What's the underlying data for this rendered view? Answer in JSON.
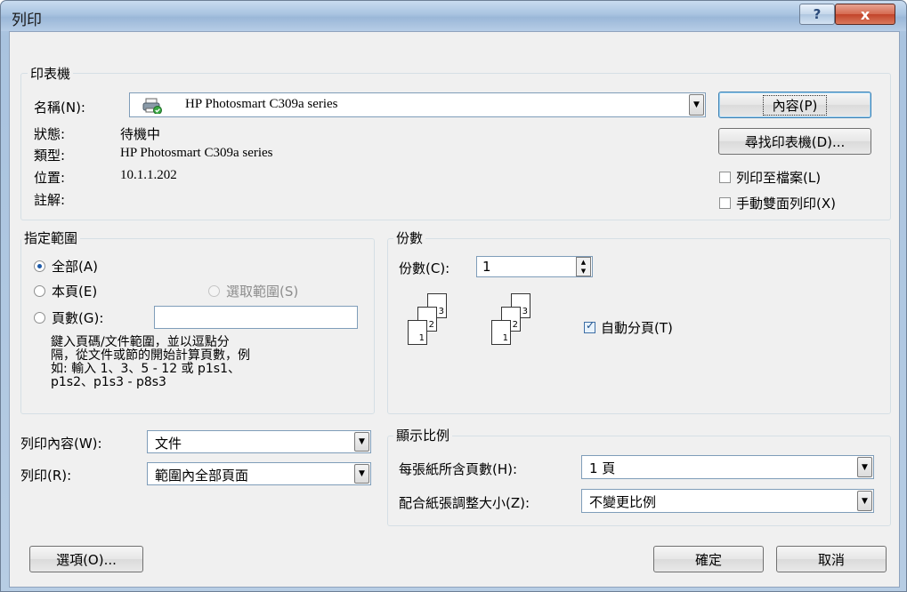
{
  "window": {
    "title": "列印",
    "help_glyph": "?",
    "close_glyph": "x"
  },
  "printer": {
    "group_label": "印表機",
    "name_label": "名稱(N):",
    "name_value": "HP Photosmart C309a series",
    "status_label": "狀態:",
    "status_value": "待機中",
    "type_label": "類型:",
    "type_value": "HP Photosmart C309a series",
    "where_label": "位置:",
    "where_value": "10.1.1.202",
    "comment_label": "註解:",
    "properties_button": "內容(P)",
    "find_button": "尋找印表機(D)...",
    "print_to_file": {
      "label": "列印至檔案(L)",
      "checked": false
    },
    "manual_duplex": {
      "label": "手動雙面列印(X)",
      "checked": false
    },
    "printer_icon": "printer-icon"
  },
  "range": {
    "group_label": "指定範圍",
    "all": {
      "label": "全部(A)",
      "checked": true
    },
    "current": {
      "label": "本頁(E)",
      "checked": false
    },
    "selection": {
      "label": "選取範圍(S)",
      "disabled": true
    },
    "pages": {
      "label": "頁數(G):",
      "value": ""
    },
    "hint_lines": [
      "鍵入頁碼/文件範圍，並以逗點分",
      "隔，從文件或節的開始計算頁數，例",
      "如: 輸入 1、3、5 - 12 或 p1s1、",
      "p1s2、p1s3 - p8s3"
    ]
  },
  "copies": {
    "group_label": "份數",
    "label": "份數(C):",
    "value": "1",
    "collate": {
      "label": "自動分頁(T)",
      "checked": true
    },
    "page_numbers": [
      "1",
      "2",
      "3"
    ]
  },
  "print_what": {
    "label": "列印內容(W):",
    "value": "文件"
  },
  "print_range": {
    "label": "列印(R):",
    "value": "範圍內全部頁面"
  },
  "zoom": {
    "group_label": "顯示比例",
    "pages_per_sheet_label": "每張紙所含頁數(H):",
    "pages_per_sheet_value": "1 頁",
    "scale_label": "配合紙張調整大小(Z):",
    "scale_value": "不變更比例"
  },
  "footer": {
    "options_button": "選項(O)...",
    "ok_button": "確定",
    "cancel_button": "取消"
  }
}
